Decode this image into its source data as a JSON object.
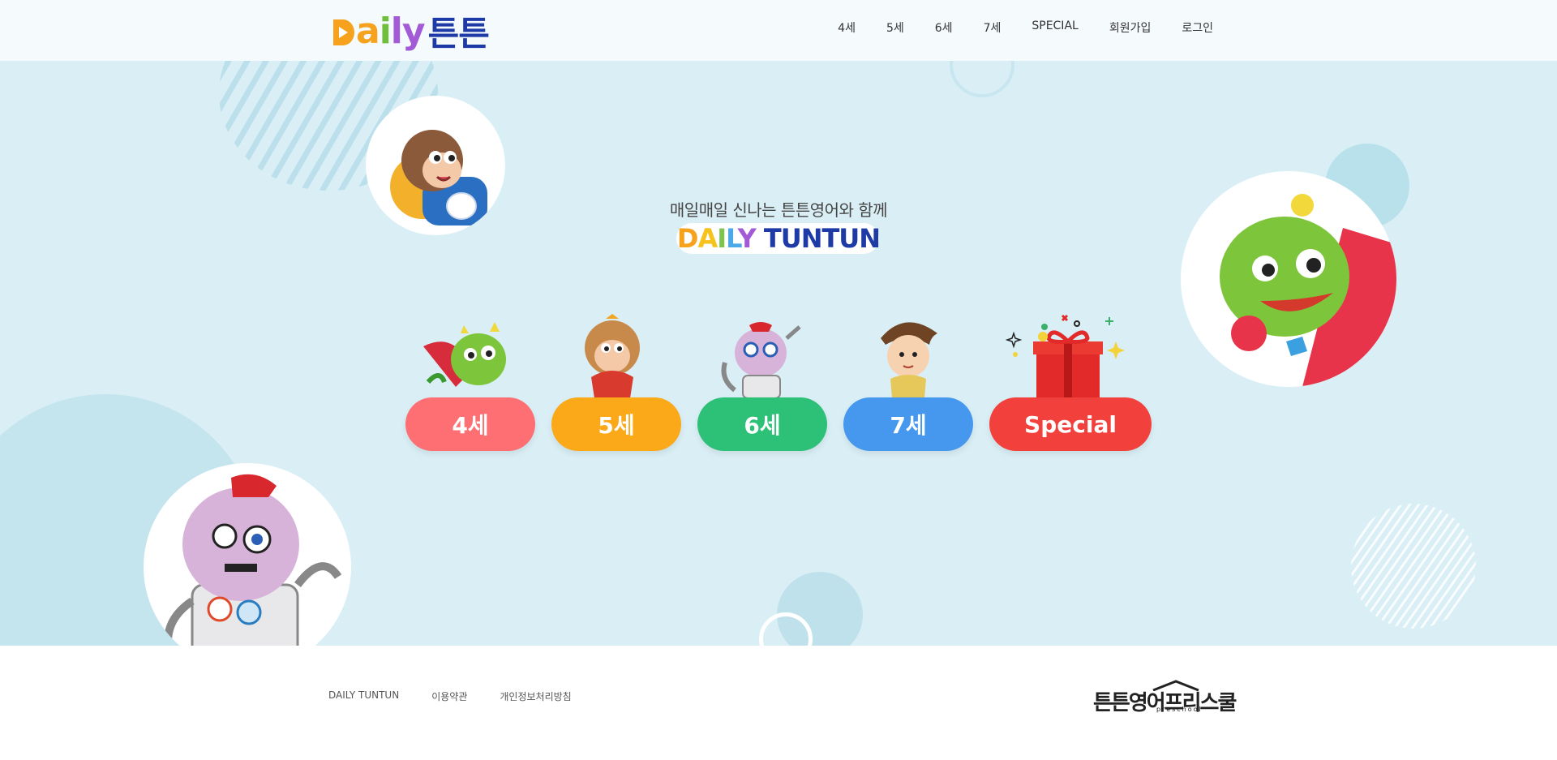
{
  "header": {
    "logo_latin": [
      "D",
      "a",
      "i",
      "l",
      "y"
    ],
    "logo_korean": "튼튼",
    "nav": [
      {
        "label": "4세"
      },
      {
        "label": "5세"
      },
      {
        "label": "6세"
      },
      {
        "label": "7세"
      },
      {
        "label": "SPECIAL"
      },
      {
        "label": "회원가입"
      },
      {
        "label": "로그인"
      }
    ]
  },
  "hero": {
    "tagline": "매일매일 신나는 튼튼영어와 함께",
    "title_parts": [
      "D",
      "A",
      "I",
      "L",
      "Y",
      "TUNTUN"
    ],
    "buttons": [
      {
        "label": "4세",
        "color": "#fd6f73",
        "mascot": "dragon-mascot-icon"
      },
      {
        "label": "5세",
        "color": "#fba819",
        "mascot": "monkey-mascot-icon"
      },
      {
        "label": "6세",
        "color": "#2cc176",
        "mascot": "robot-mascot-icon"
      },
      {
        "label": "7세",
        "color": "#4698ef",
        "mascot": "boy-mascot-icon"
      },
      {
        "label": "Special",
        "color": "#f2413d",
        "mascot": "gift-icon"
      }
    ]
  },
  "footer": {
    "links": [
      {
        "label": "DAILY TUNTUN"
      },
      {
        "label": "이용약관"
      },
      {
        "label": "개인정보처리방침"
      }
    ],
    "brand": "튼튼영어프리스쿨",
    "brand_sub": "preschool"
  },
  "colors": {
    "hero_bg": "#d9eff5",
    "header_bg": "#f5fafd",
    "brand_blue": "#1d3aa6",
    "brand_orange": "#f6a21c"
  }
}
